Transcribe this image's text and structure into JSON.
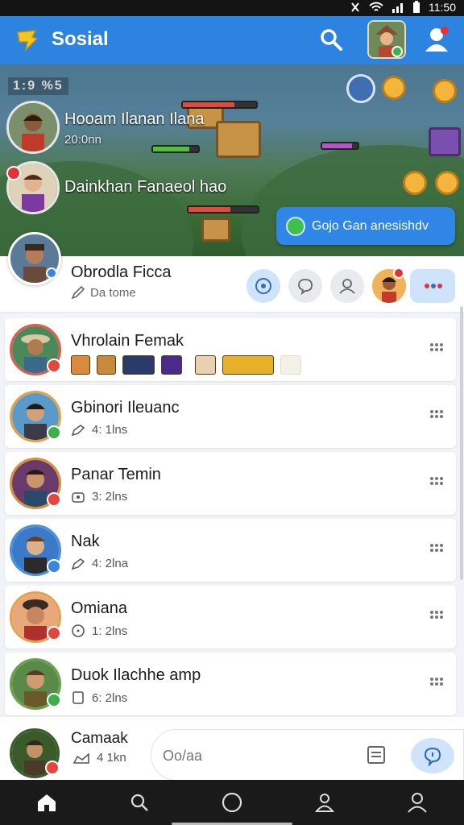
{
  "status_bar": {
    "time": "11:50"
  },
  "app": {
    "title": "Sosial"
  },
  "banner": {
    "hud_text": "1:9 %5",
    "friend1_name": "Hooam Ilanan Ilana",
    "friend1_sub": "20:0nn",
    "friend2_name": "Dainkhan Fanaeol hao",
    "join_button": "Gojo Gan anesishdv"
  },
  "featured": {
    "name": "Obrodla Ficca",
    "sub": "Da tome"
  },
  "friends": [
    {
      "name": "Vhrolain Femak",
      "meta": "",
      "badge": "red"
    },
    {
      "name": "Gbinori Ileuanc",
      "meta": "4: 1lns",
      "badge": "green"
    },
    {
      "name": "Panar Temin",
      "meta": "3: 2lns",
      "badge": "red"
    },
    {
      "name": "Nak",
      "meta": "4: 2lna",
      "badge": "blue"
    },
    {
      "name": "Omiana",
      "meta": "1: 2lns",
      "badge": "red"
    },
    {
      "name": "Duok Ilachhe amp",
      "meta": "6: 2lns",
      "badge": "green"
    }
  ],
  "bottom_friend": {
    "name": "Camaak",
    "meta": "4 1kn"
  },
  "composer": {
    "placeholder": "Oo/aa"
  },
  "icons": {
    "search": "search-icon",
    "profile": "profile-icon",
    "more": "more-dots-icon",
    "home": "home-icon"
  },
  "colors": {
    "accent": "#2d83e0",
    "online": "#3bb24a",
    "alert": "#e0333a"
  }
}
